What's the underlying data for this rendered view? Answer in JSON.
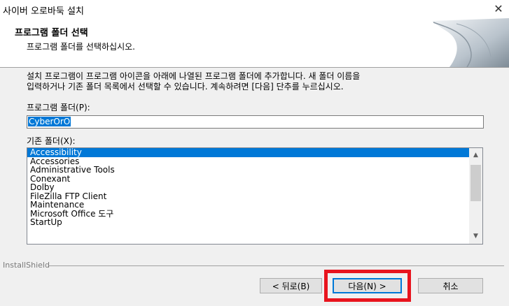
{
  "window": {
    "title": "사이버 오로바둑 설치",
    "close_glyph": "✕"
  },
  "header": {
    "title": "프로그램 폴더 선택",
    "subtitle": "프로그램 폴더를 선택하십시오."
  },
  "instructions": [
    "설치 프로그램이 프로그램 아이콘을 아래에 나열된 프로그램 폴더에 추가합니다. 새 폴더 이름을",
    "입력하거나 기존 폴더 목록에서 선택할 수 있습니다. 계속하려면 [다음] 단추를 누르십시오."
  ],
  "program_folder": {
    "label": "프로그램 폴더(P):",
    "value": "CyberOrO"
  },
  "existing_folders": {
    "label": "기존 폴더(X):",
    "items": [
      "Accessibility",
      "Accessories",
      "Administrative Tools",
      "Conexant",
      "Dolby",
      "FileZilla FTP Client",
      "Maintenance",
      "Microsoft Office 도구",
      "StartUp"
    ],
    "selected": "Accessibility"
  },
  "footer": {
    "brand": "InstallShield",
    "back_label": "< 뒤로(B)",
    "next_label": "다음(N) >",
    "cancel_label": "취소"
  },
  "colors": {
    "selection": "#0078d7",
    "highlight_box": "#e8141e"
  }
}
